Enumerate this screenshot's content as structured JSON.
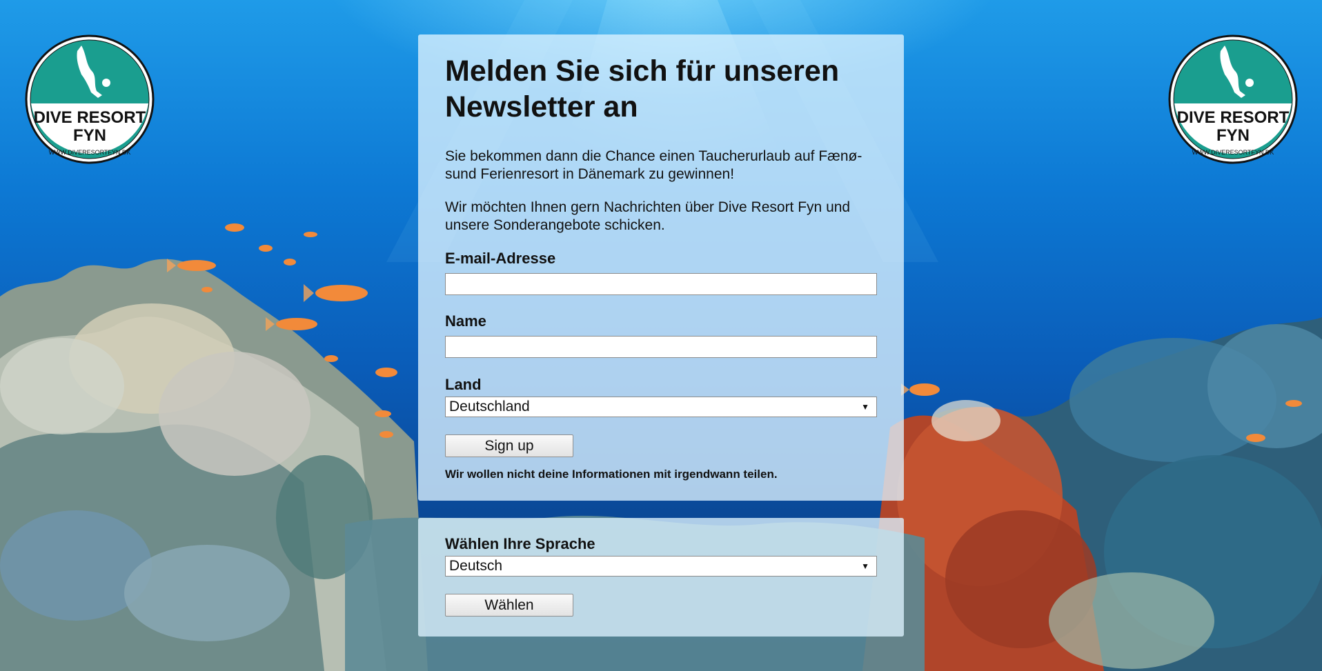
{
  "logo": {
    "name_line1": "DIVE RESORT",
    "name_line2": "FYN",
    "url": "WWW.DIVERESORTFYN.DK",
    "color_teal": "#1a9e8f"
  },
  "signup": {
    "title": "Melden Sie sich für unseren Newsletter an",
    "paragraph1": "Sie bekommen dann die Chance einen Taucherurlaub auf Fænø-sund Ferienresort in Dänemark zu gewinnen!",
    "paragraph2": "Wir möchten Ihnen gern Nachrichten über Dive Resort Fyn und unsere Sonderangebote schicken.",
    "email_label": "E-mail-Adresse",
    "email_value": "",
    "name_label": "Name",
    "name_value": "",
    "country_label": "Land",
    "country_selected": "Deutschland",
    "submit_label": "Sign up",
    "privacy_note": "Wir wollen nicht deine Informationen mit irgendwann teilen."
  },
  "language": {
    "label": "Wählen Ihre Sprache",
    "selected": "Deutsch",
    "submit_label": "Wählen"
  }
}
